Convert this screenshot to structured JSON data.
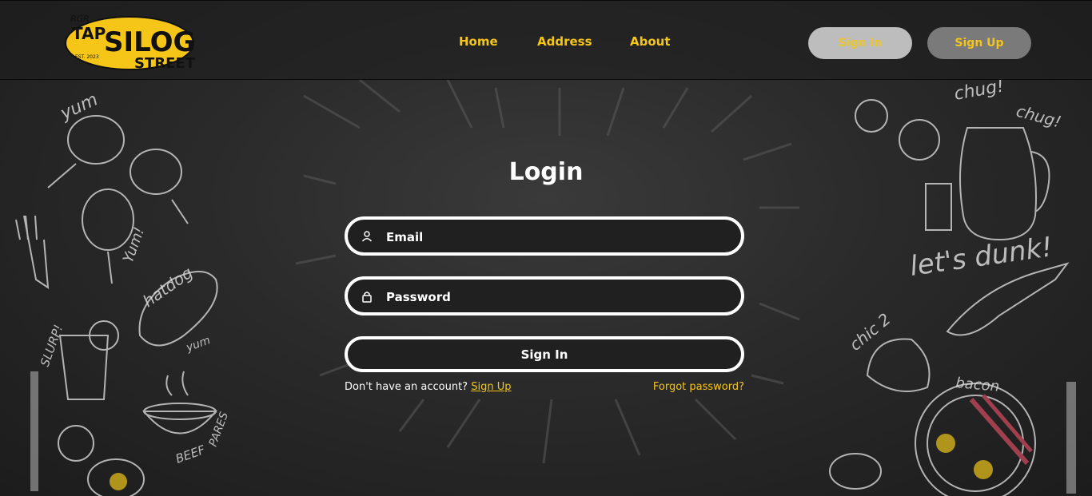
{
  "brand": {
    "logo_text_small": "RGR",
    "logo_text_tap": "TAP",
    "logo_text_silog": "SILOG",
    "logo_text_street": "STREET",
    "logo_text_est": "EST. 2023",
    "colors": {
      "accent": "#f5c518",
      "background": "#262626",
      "field": "#202020"
    }
  },
  "nav": {
    "links": [
      {
        "label": "Home"
      },
      {
        "label": "Address"
      },
      {
        "label": "About"
      }
    ],
    "sign_in_label": "Sign In",
    "sign_up_label": "Sign Up"
  },
  "login": {
    "title": "Login",
    "email_placeholder": "Email",
    "password_placeholder": "Password",
    "email_icon": "user-icon",
    "password_icon": "lock-icon",
    "submit_label": "Sign In",
    "no_account_text": "Don't have an account?",
    "sign_up_link": "Sign Up",
    "forgot_link": "Forgot password?"
  },
  "decor": {
    "left_doodles": [
      "yum",
      "Yum!",
      "hatdog",
      "yum",
      "SLURP!",
      "BEEF",
      "PARES"
    ],
    "right_doodles": [
      "chug!",
      "chug!",
      "let's dunk!",
      "chic 2",
      "bacon"
    ]
  }
}
